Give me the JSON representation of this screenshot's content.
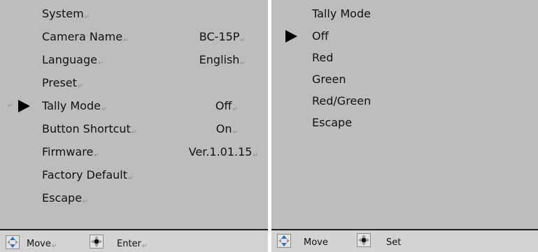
{
  "left_menu": {
    "items": [
      {
        "label": "System",
        "value": ""
      },
      {
        "label": "Camera Name",
        "value": "BC-15P"
      },
      {
        "label": "Language",
        "value": "English"
      },
      {
        "label": "Preset",
        "value": ""
      },
      {
        "label": "Tally Mode",
        "value": "Off"
      },
      {
        "label": "Button Shortcut",
        "value": "On"
      },
      {
        "label": "Firmware",
        "value": "Ver.1.01.15"
      },
      {
        "label": "Factory Default",
        "value": ""
      },
      {
        "label": "Escape",
        "value": ""
      }
    ],
    "selected_index": 4
  },
  "left_footer": {
    "move_label": "Move",
    "enter_label": "Enter"
  },
  "right_menu": {
    "title": "Tally Mode",
    "options": [
      "Off",
      "Red",
      "Green",
      "Red/Green",
      "Escape"
    ],
    "selected_index": 0
  },
  "right_footer": {
    "move_label": "Move",
    "set_label": "Set"
  },
  "colors": {
    "panel_bg": "#bdbdbd",
    "footer_bg": "#d3d3d3",
    "text": "#111111"
  },
  "icons": {
    "move": "dpad-updown-icon",
    "enter": "dpad-center-icon",
    "pointer": "selection-arrow-icon",
    "return_mark": "return-mark-icon"
  }
}
